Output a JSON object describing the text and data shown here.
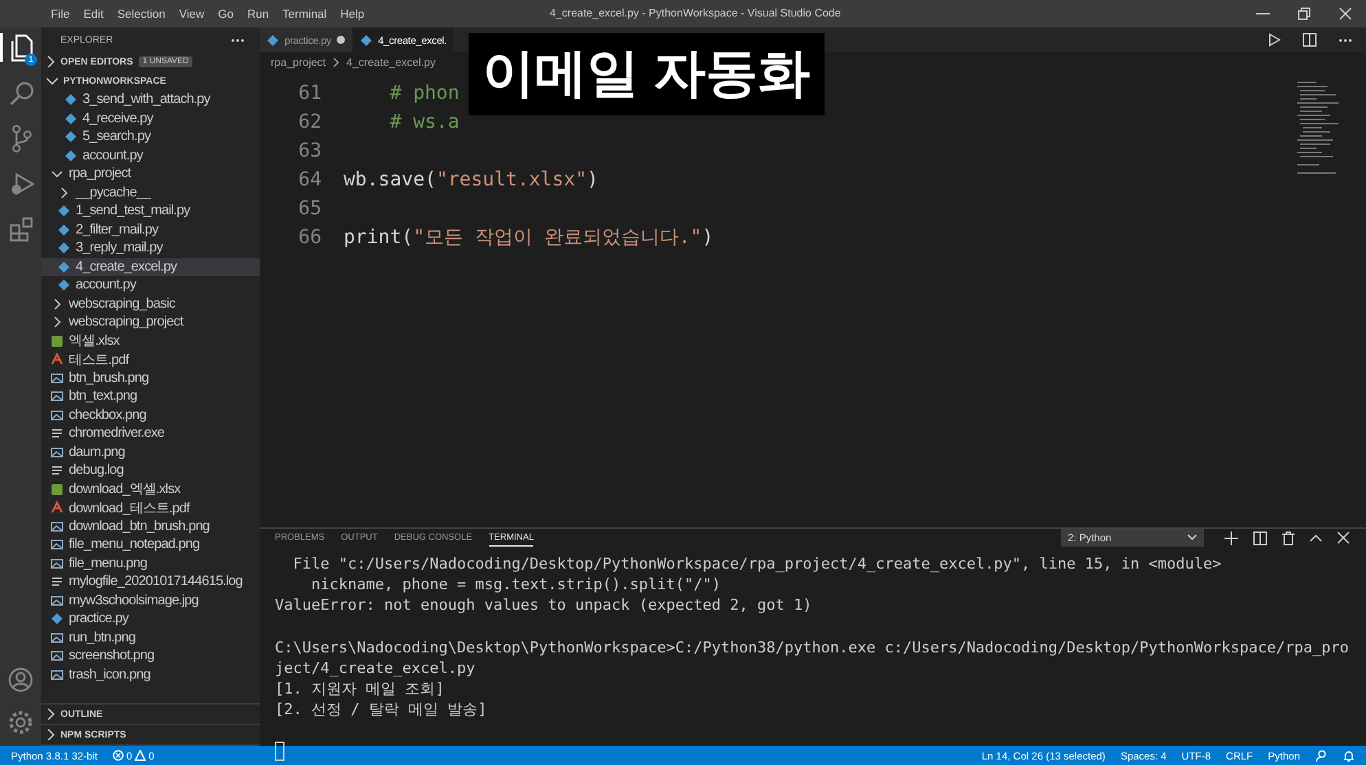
{
  "window": {
    "title": "4_create_excel.py - PythonWorkspace - Visual Studio Code"
  },
  "menu": [
    "File",
    "Edit",
    "Selection",
    "View",
    "Go",
    "Run",
    "Terminal",
    "Help"
  ],
  "activity_bar": [
    {
      "kind": "files",
      "selected": true,
      "badge": "1"
    },
    {
      "kind": "search",
      "selected": false
    },
    {
      "kind": "source-control",
      "selected": false
    },
    {
      "kind": "run",
      "selected": false
    },
    {
      "kind": "extensions",
      "selected": false
    }
  ],
  "activity_bottom": [
    {
      "kind": "account"
    },
    {
      "kind": "settings"
    }
  ],
  "explorer": {
    "title": "EXPLORER",
    "open_editors": {
      "label": "OPEN EDITORS",
      "expanded": false,
      "badge": "1 UNSAVED"
    },
    "workspace": {
      "label": "PYTHONWORKSPACE",
      "expanded": true
    },
    "tree": [
      {
        "kind": "continued",
        "children": [
          {
            "kind": "py",
            "name": "3_send_with_attach.py",
            "selected": false
          },
          {
            "kind": "py",
            "name": "4_receive.py",
            "selected": false
          },
          {
            "kind": "py",
            "name": "5_search.py",
            "selected": false
          },
          {
            "kind": "py",
            "name": "account.py",
            "selected": false
          }
        ]
      },
      {
        "kind": "folder",
        "name": "rpa_project",
        "expanded": true,
        "selected": false,
        "children": [
          {
            "kind": "folder",
            "name": "__pycache__",
            "expanded": false,
            "selected": false
          },
          {
            "kind": "py",
            "name": "1_send_test_mail.py",
            "selected": false
          },
          {
            "kind": "py",
            "name": "2_filter_mail.py",
            "selected": false
          },
          {
            "kind": "py",
            "name": "3_reply_mail.py",
            "selected": false
          },
          {
            "kind": "py",
            "name": "4_create_excel.py",
            "selected": true
          },
          {
            "kind": "py",
            "name": "account.py",
            "selected": false
          }
        ]
      },
      {
        "kind": "folder",
        "name": "webscraping_basic",
        "expanded": false,
        "selected": false
      },
      {
        "kind": "folder",
        "name": "webscraping_project",
        "expanded": false,
        "selected": false
      },
      {
        "kind": "excel",
        "name": "엑셀.xlsx",
        "selected": false
      },
      {
        "kind": "pdf",
        "name": "테스트.pdf",
        "selected": false
      },
      {
        "kind": "image",
        "name": "btn_brush.png",
        "selected": false
      },
      {
        "kind": "image",
        "name": "btn_text.png",
        "selected": false
      },
      {
        "kind": "image",
        "name": "checkbox.png",
        "selected": false
      },
      {
        "kind": "text",
        "name": "chromedriver.exe",
        "selected": false
      },
      {
        "kind": "image",
        "name": "daum.png",
        "selected": false
      },
      {
        "kind": "text",
        "name": "debug.log",
        "selected": false
      },
      {
        "kind": "excel",
        "name": "download_엑셀.xlsx",
        "selected": false
      },
      {
        "kind": "pdf",
        "name": "download_테스트.pdf",
        "selected": false
      },
      {
        "kind": "image",
        "name": "download_btn_brush.png",
        "selected": false
      },
      {
        "kind": "image",
        "name": "file_menu_notepad.png",
        "selected": false
      },
      {
        "kind": "image",
        "name": "file_menu.png",
        "selected": false
      },
      {
        "kind": "text",
        "name": "mylogfile_20201017144615.log",
        "selected": false
      },
      {
        "kind": "image",
        "name": "myw3schoolsimage.jpg",
        "selected": false
      },
      {
        "kind": "py",
        "name": "practice.py",
        "selected": false
      },
      {
        "kind": "image",
        "name": "run_btn.png",
        "selected": false
      },
      {
        "kind": "image",
        "name": "screenshot.png",
        "selected": false
      },
      {
        "kind": "image",
        "name": "trash_icon.png",
        "selected": false
      }
    ],
    "bottom_sections": [
      {
        "label": "OUTLINE",
        "expanded": false
      },
      {
        "label": "NPM SCRIPTS",
        "expanded": false
      }
    ]
  },
  "tabs": [
    {
      "label": "practice.py",
      "selected": false,
      "dirty": true
    },
    {
      "label": "4_create_excel.",
      "selected": true,
      "dirty": false
    }
  ],
  "breadcrumbs": [
    "rpa_project",
    "4_create_excel.py"
  ],
  "code": [
    {
      "number": "61",
      "tokens": [
        {
          "kind": "comment",
          "text": "    # phon"
        }
      ]
    },
    {
      "number": "62",
      "tokens": [
        {
          "kind": "comment",
          "text": "    # ws.a"
        }
      ]
    },
    {
      "number": "63"
    },
    {
      "number": "64",
      "tokens": [
        {
          "kind": "plain",
          "text": "wb.save("
        },
        {
          "kind": "string",
          "text": "\"result.xlsx\""
        },
        {
          "kind": "plain",
          "text": ")"
        }
      ]
    },
    {
      "number": "65"
    },
    {
      "number": "66",
      "tokens": [
        {
          "kind": "plain",
          "text": "print("
        },
        {
          "kind": "string",
          "text": "\"모든 작업이 완료되었습니다.\""
        },
        {
          "kind": "plain",
          "text": ")"
        }
      ]
    }
  ],
  "caption": "이메일 자동화",
  "panel": {
    "tabs": [
      {
        "label": "PROBLEMS",
        "selected": false
      },
      {
        "label": "OUTPUT",
        "selected": false
      },
      {
        "label": "DEBUG CONSOLE",
        "selected": false
      },
      {
        "label": "TERMINAL",
        "selected": true
      }
    ],
    "terminal_select": "2: Python",
    "terminal_groups": [
      [
        "  File \"c:/Users/Nadocoding/Desktop/PythonWorkspace/rpa_project/4_create_excel.py\", line 15, in <module>",
        "    nickname, phone = msg.text.strip().split(\"/\")",
        "ValueError: not enough values to unpack (expected 2, got 1)"
      ],
      [
        "C:\\Users\\Nadocoding\\Desktop\\PythonWorkspace>C:/Python38/python.exe c:/Users/Nadocoding/Desktop/PythonWorkspace/rpa_project/4_create_excel.py",
        "[1. 지원자 메일 조회]",
        "[2. 선정 / 탈락 메일 발송]"
      ]
    ],
    "cursor": true
  },
  "status_bar": {
    "interpreter": "Python 3.8.1 32-bit",
    "errors": "0",
    "warnings": "0",
    "right": [
      "Ln 14, Col 26 (13 selected)",
      "Spaces: 4",
      "UTF-8",
      "CRLF",
      "Python"
    ]
  }
}
